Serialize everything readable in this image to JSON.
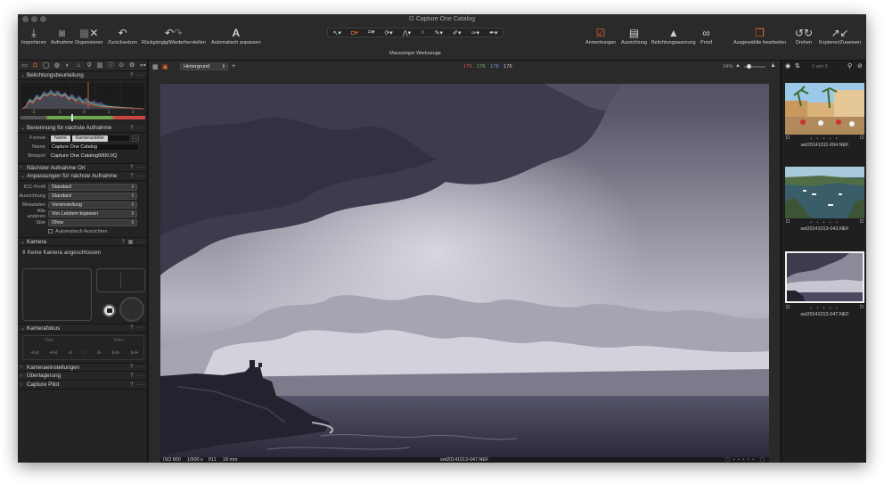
{
  "window": {
    "title": "Capture One Catalog"
  },
  "toolbar": {
    "left": [
      {
        "label": "Importieren",
        "icon": "import-icon"
      },
      {
        "label": "Aufnahme",
        "icon": "camera-icon"
      },
      {
        "label": "Organisieren",
        "icon": "organize-icon"
      },
      {
        "label": "Zurücksetzen",
        "icon": "reset-icon"
      },
      {
        "label": "Rückgängig/Wiederherstellen",
        "icon": "undo-redo-icon"
      },
      {
        "label": "Automatisch anpassen",
        "icon": "auto-adjust-icon"
      }
    ],
    "cursor_tools_label": "Mauszeiger Werkzeuge",
    "right": [
      {
        "label": "Anmerkungen",
        "icon": "annotations-icon"
      },
      {
        "label": "Ausrichtung",
        "icon": "orientation-icon"
      },
      {
        "label": "Belichtungswarnung",
        "icon": "exposure-warning-icon"
      },
      {
        "label": "Proof",
        "icon": "proof-glasses-icon"
      },
      {
        "label": "Ausgewählte bearbeiten",
        "icon": "edit-selected-icon"
      },
      {
        "label": "Drehen",
        "icon": "rotate-icon"
      },
      {
        "label": "Kopieren/Zuweisen",
        "icon": "copy-apply-icon"
      }
    ],
    "accent_color": "#e56a2b"
  },
  "left_panel": {
    "exposure_evaluation": {
      "title": "Belichtungsbeurteilung",
      "scale": [
        "-2",
        "-1",
        "0",
        "1",
        "2"
      ]
    },
    "naming": {
      "title": "Benennung für nächste Aufnahme",
      "format_label": "Format",
      "format_tokens": [
        "Name",
        "Kamerazähler"
      ],
      "name_label": "Name",
      "name_value": "Capture One Catalog",
      "example_label": "Beispiel",
      "example_value": "Capture One Catalog0000.IIQ"
    },
    "next_capture_location": {
      "title": "Nächster Aufnahme Ort"
    },
    "adjustments": {
      "title": "Anpassungen für nächste Aufnahme",
      "rows": [
        {
          "label": "ICC-Profil",
          "value": "Standard"
        },
        {
          "label": "Ausrichtung",
          "value": "Standard"
        },
        {
          "label": "Metadaten",
          "value": "Voreinstellung"
        },
        {
          "label": "Alle anderen",
          "value": "Von Letztem kopieren"
        },
        {
          "label": "Stile",
          "value": "Ohne"
        }
      ],
      "auto_align_label": "Automatisch Ausrichten"
    },
    "camera": {
      "title": "Kamera",
      "status": "Keine Kamera angeschlossen"
    },
    "camera_focus": {
      "title": "Kamerafokus",
      "near": "Nah",
      "far": "Fern"
    },
    "collapsed_sections": [
      "Kameraeinstellungen",
      "Überlagerung",
      "Capture Pilot"
    ]
  },
  "viewer": {
    "background_option": "Hintergrund",
    "rgb": {
      "r": "176",
      "g": "176",
      "b": "178",
      "l": "176"
    },
    "zoom": "34%",
    "count": "1 von 3",
    "info": {
      "iso": "ISO 800",
      "shutter": "1/500 s",
      "aperture": "f/11",
      "focal": "18 mm",
      "filename": "set20141013-047.NEF"
    }
  },
  "browser": {
    "items": [
      {
        "filename": "set20141011-004.NEF",
        "stars": "• • • • •"
      },
      {
        "filename": "set20141013-043.NEF",
        "stars": "• • • • •"
      },
      {
        "filename": "set20141013-047.NEF",
        "stars": "• • • • •"
      }
    ]
  }
}
